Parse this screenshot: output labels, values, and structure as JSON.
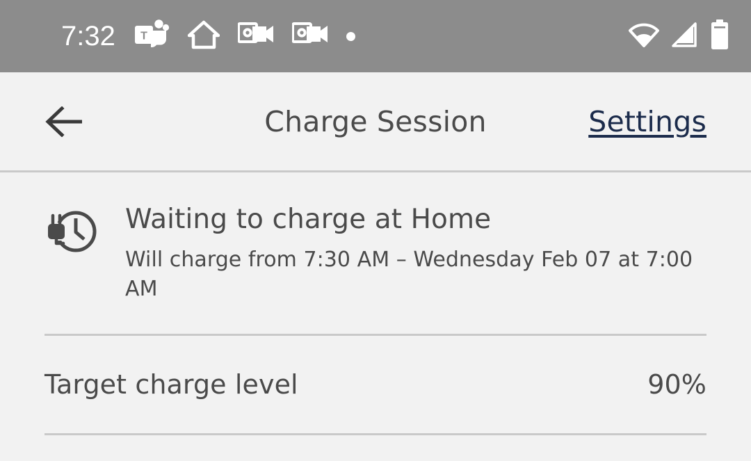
{
  "status_bar": {
    "time": "7:32",
    "background_color": "#8C8C8C",
    "icon_color": "#FFFFFF",
    "notification_icons": [
      {
        "name": "microsoft-teams-icon",
        "label": "Microsoft Teams"
      },
      {
        "name": "home-icon",
        "label": "Home"
      },
      {
        "name": "outlook-meeting-icon",
        "label": "Outlook"
      },
      {
        "name": "outlook-meeting-icon-2",
        "label": "Outlook"
      },
      {
        "name": "more-notifications-dot",
        "label": "More notifications"
      }
    ],
    "system_icons": [
      {
        "name": "wifi-icon",
        "label": "Wi-Fi"
      },
      {
        "name": "cellular-signal-icon",
        "label": "Cellular signal"
      },
      {
        "name": "battery-icon",
        "label": "Battery full"
      }
    ]
  },
  "header": {
    "back_label": "Back",
    "title": "Charge Session",
    "settings_label": "Settings",
    "link_color": "#1B2B4B",
    "text_color": "#4A4A4A",
    "background_color": "#F2F2F2"
  },
  "main": {
    "status": {
      "icon": "plug-clock-icon",
      "headline": "Waiting to charge at Home",
      "detail": "Will charge from 7:30 AM – Wednesday Feb 07 at 7:00 AM"
    },
    "rows": [
      {
        "name": "target-charge-level",
        "label": "Target charge level",
        "value": "90%"
      }
    ]
  },
  "theme": {
    "page_background": "#F2F2F2",
    "divider_color": "#C9C9C9",
    "primary_text": "#4A4A4A"
  }
}
